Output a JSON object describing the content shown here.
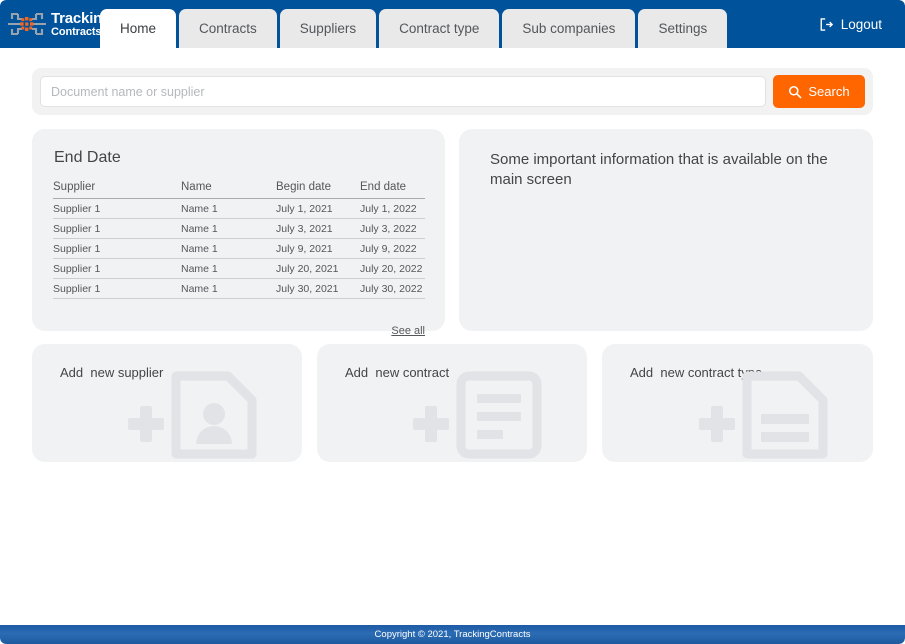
{
  "brand": {
    "line1": "Tracking",
    "line2": "Contracts",
    "mark_icon": "circuit-asterisk-logo-icon",
    "frame_color": "#9aa3ab",
    "dot_color": "#f26522"
  },
  "header": {
    "background": "#00529b",
    "tabs": [
      {
        "label": "Home",
        "active": true
      },
      {
        "label": "Contracts",
        "active": false
      },
      {
        "label": "Suppliers",
        "active": false
      },
      {
        "label": "Contract type",
        "active": false
      },
      {
        "label": "Sub companies",
        "active": false
      },
      {
        "label": "Settings",
        "active": false
      }
    ],
    "logout": {
      "label": "Logout",
      "icon": "sign-out-icon"
    }
  },
  "search": {
    "placeholder": "Document name or supplier",
    "value": "",
    "button_label": "Search",
    "button_icon": "search-icon",
    "button_color": "#ff6600"
  },
  "end_date_panel": {
    "title": "End Date",
    "columns": [
      "Supplier",
      "Name",
      "Begin date",
      "End date"
    ],
    "rows": [
      [
        "Supplier 1",
        "Name 1",
        "July 1, 2021",
        "July 1, 2022"
      ],
      [
        "Supplier 1",
        "Name 1",
        "July 3, 2021",
        "July 3, 2022"
      ],
      [
        "Supplier 1",
        "Name 1",
        "July 9, 2021",
        "July 9, 2022"
      ],
      [
        "Supplier 1",
        "Name 1",
        "July 20, 2021",
        "July 20, 2022"
      ],
      [
        "Supplier 1",
        "Name 1",
        "July 30, 2021",
        "July 30, 2022"
      ]
    ],
    "see_all_label": "See all"
  },
  "info_panel": {
    "text": "Some important information that is available on the main screen"
  },
  "add_cards": [
    {
      "label": "Add  new supplier",
      "icon": "document-person-plus-icon"
    },
    {
      "label": "Add  new contract",
      "icon": "clipboard-lines-plus-icon"
    },
    {
      "label": "Add  new contract type",
      "icon": "document-lines-plus-icon"
    }
  ],
  "footer": {
    "text": "Copyright © 2021, TrackingContracts"
  }
}
